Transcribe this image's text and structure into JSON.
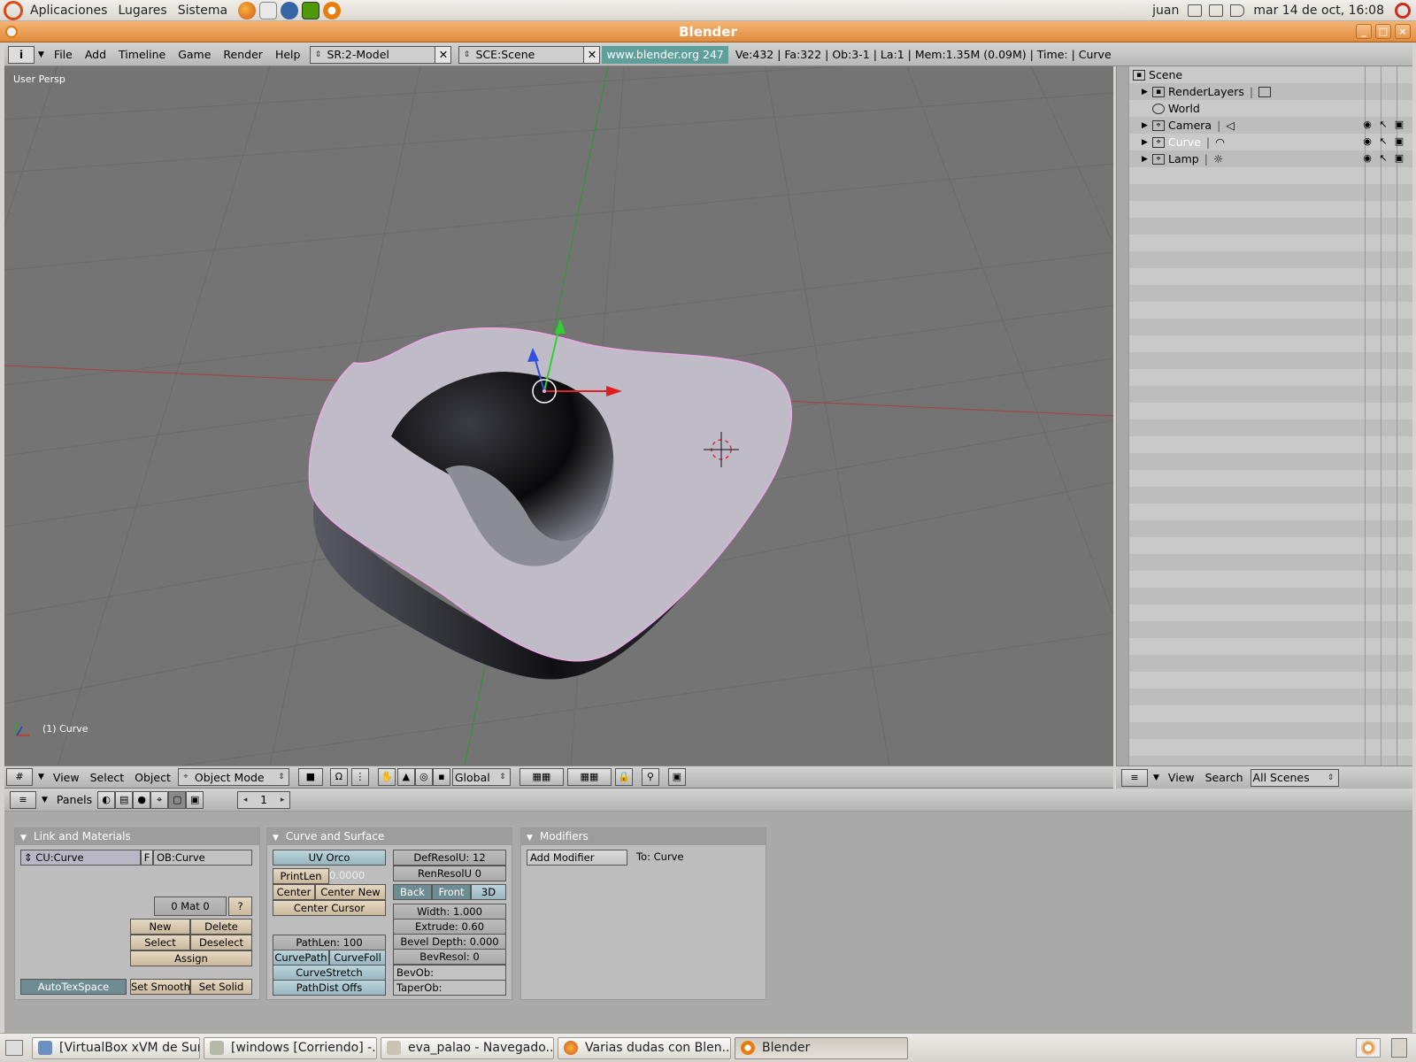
{
  "gnome_panel": {
    "menus": [
      "Aplicaciones",
      "Lugares",
      "Sistema"
    ],
    "user": "juan",
    "datetime": "mar 14 de oct, 16:08"
  },
  "window": {
    "title": "Blender"
  },
  "info_header": {
    "menus": [
      "File",
      "Add",
      "Timeline",
      "Game",
      "Render",
      "Help"
    ],
    "screen": "SR:2-Model",
    "scene": "SCE:Scene",
    "url": "www.blender.org 247",
    "stats": "Ve:432 | Fa:322 | Ob:3-1 | La:1  | Mem:1.35M (0.09M)  | Time: | Curve"
  },
  "viewport": {
    "view_label": "User Persp",
    "object_label": "(1) Curve"
  },
  "outliner": {
    "items": [
      {
        "label": "Scene",
        "icon": "scene-icon"
      },
      {
        "label": "RenderLayers",
        "icon": "renderlayers-icon"
      },
      {
        "label": "World",
        "icon": "world-icon"
      },
      {
        "label": "Camera",
        "icon": "camera-icon"
      },
      {
        "label": "Curve",
        "icon": "curve-icon"
      },
      {
        "label": "Lamp",
        "icon": "lamp-icon"
      }
    ]
  },
  "view3d_header": {
    "menus": [
      "View",
      "Select",
      "Object"
    ],
    "mode": "Object Mode",
    "orientation": "Global"
  },
  "outliner_header": {
    "menus": [
      "View",
      "Search"
    ],
    "scope": "All Scenes"
  },
  "buttons_header": {
    "panels_label": "Panels",
    "frame": "1"
  },
  "link_materials": {
    "title": "Link and Materials",
    "cu_field": "CU:Curve",
    "f_btn": "F",
    "ob_field": "OB:Curve",
    "mat_counter": "0 Mat 0",
    "help": "?",
    "new": "New",
    "delete": "Delete",
    "select": "Select",
    "deselect": "Deselect",
    "assign": "Assign",
    "autotexspace": "AutoTexSpace",
    "set_smooth": "Set Smooth",
    "set_solid": "Set Solid"
  },
  "curve_surface": {
    "title": "Curve and Surface",
    "uv_orco": "UV Orco",
    "printlen": "PrintLen",
    "printlen_value": "0.0000",
    "center": "Center",
    "center_new": "Center New",
    "center_cursor": "Center Cursor",
    "pathlen": "PathLen: 100",
    "curvepath": "CurvePath",
    "curvefoll": "CurveFoll",
    "curvestretch": "CurveStretch",
    "pathdist": "PathDist Offs",
    "defresolu": "DefResolU: 12",
    "renresolu": "RenResolU 0",
    "back": "Back",
    "front": "Front",
    "d3": "3D",
    "width": "Width: 1.000",
    "extrude": "Extrude: 0.60",
    "bevel_depth": "Bevel Depth: 0.000",
    "bevresol": "BevResol: 0",
    "bevob": "BevOb:",
    "taperob": "TaperOb:"
  },
  "modifiers": {
    "title": "Modifiers",
    "add": "Add Modifier",
    "to": "To: Curve"
  },
  "taskbar": {
    "tasks": [
      "[VirtualBox xVM de Sun]",
      "[windows [Corriendo] -...",
      "eva_palao - Navegado...",
      "Varias dudas con Blen...",
      "Blender"
    ]
  },
  "colors": {
    "title_bar": "#e08b3c",
    "viewport_bg": "#747474",
    "selection_outline": "#f0a8e8",
    "url_bg": "#5fa09a"
  }
}
